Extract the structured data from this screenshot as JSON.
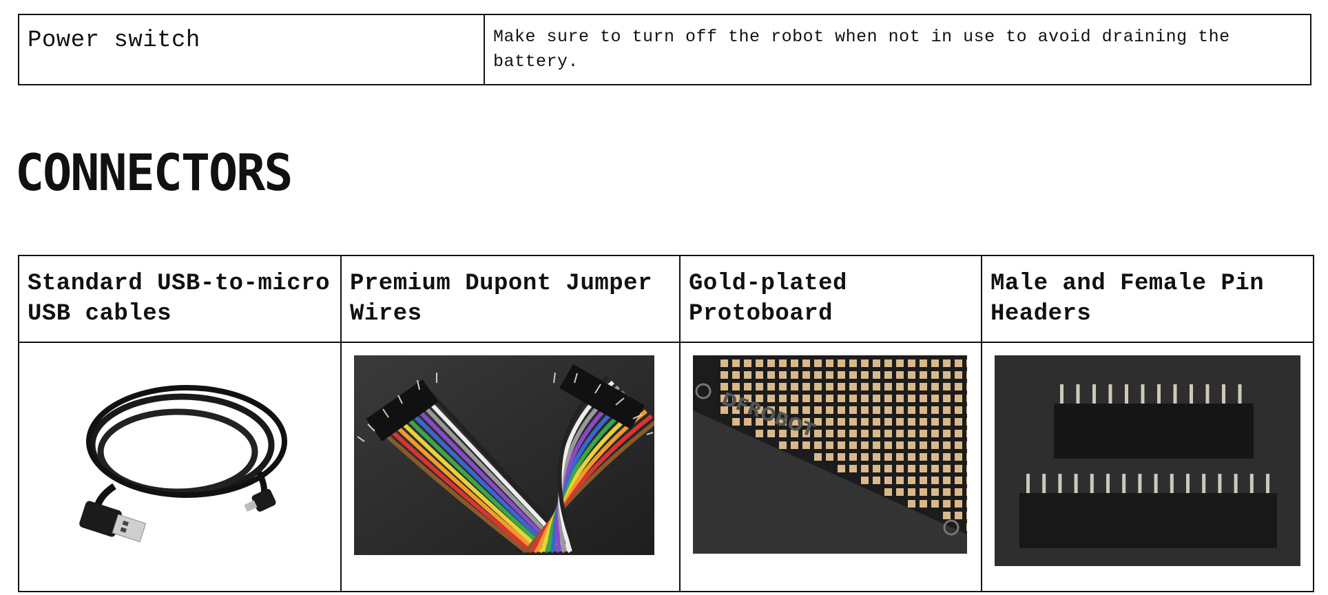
{
  "top_table": {
    "label": "Power switch",
    "description": "Make sure to turn off the robot when not in use to avoid draining the battery."
  },
  "section_title": "CONNECTORS",
  "connectors": [
    {
      "header": "Standard USB-to-micro USB cables",
      "image": "usb-cable-photo"
    },
    {
      "header": "Premium Dupont Jumper Wires",
      "image": "jumper-wires-photo"
    },
    {
      "header": "Gold-plated Protoboard",
      "image": "protoboard-photo"
    },
    {
      "header": "Male and Female Pin Headers",
      "image": "pin-headers-photo"
    }
  ],
  "protoboard_print": "DFROBOT",
  "colors": {
    "border": "#111111",
    "photo_dark": "#2b2b2b"
  }
}
